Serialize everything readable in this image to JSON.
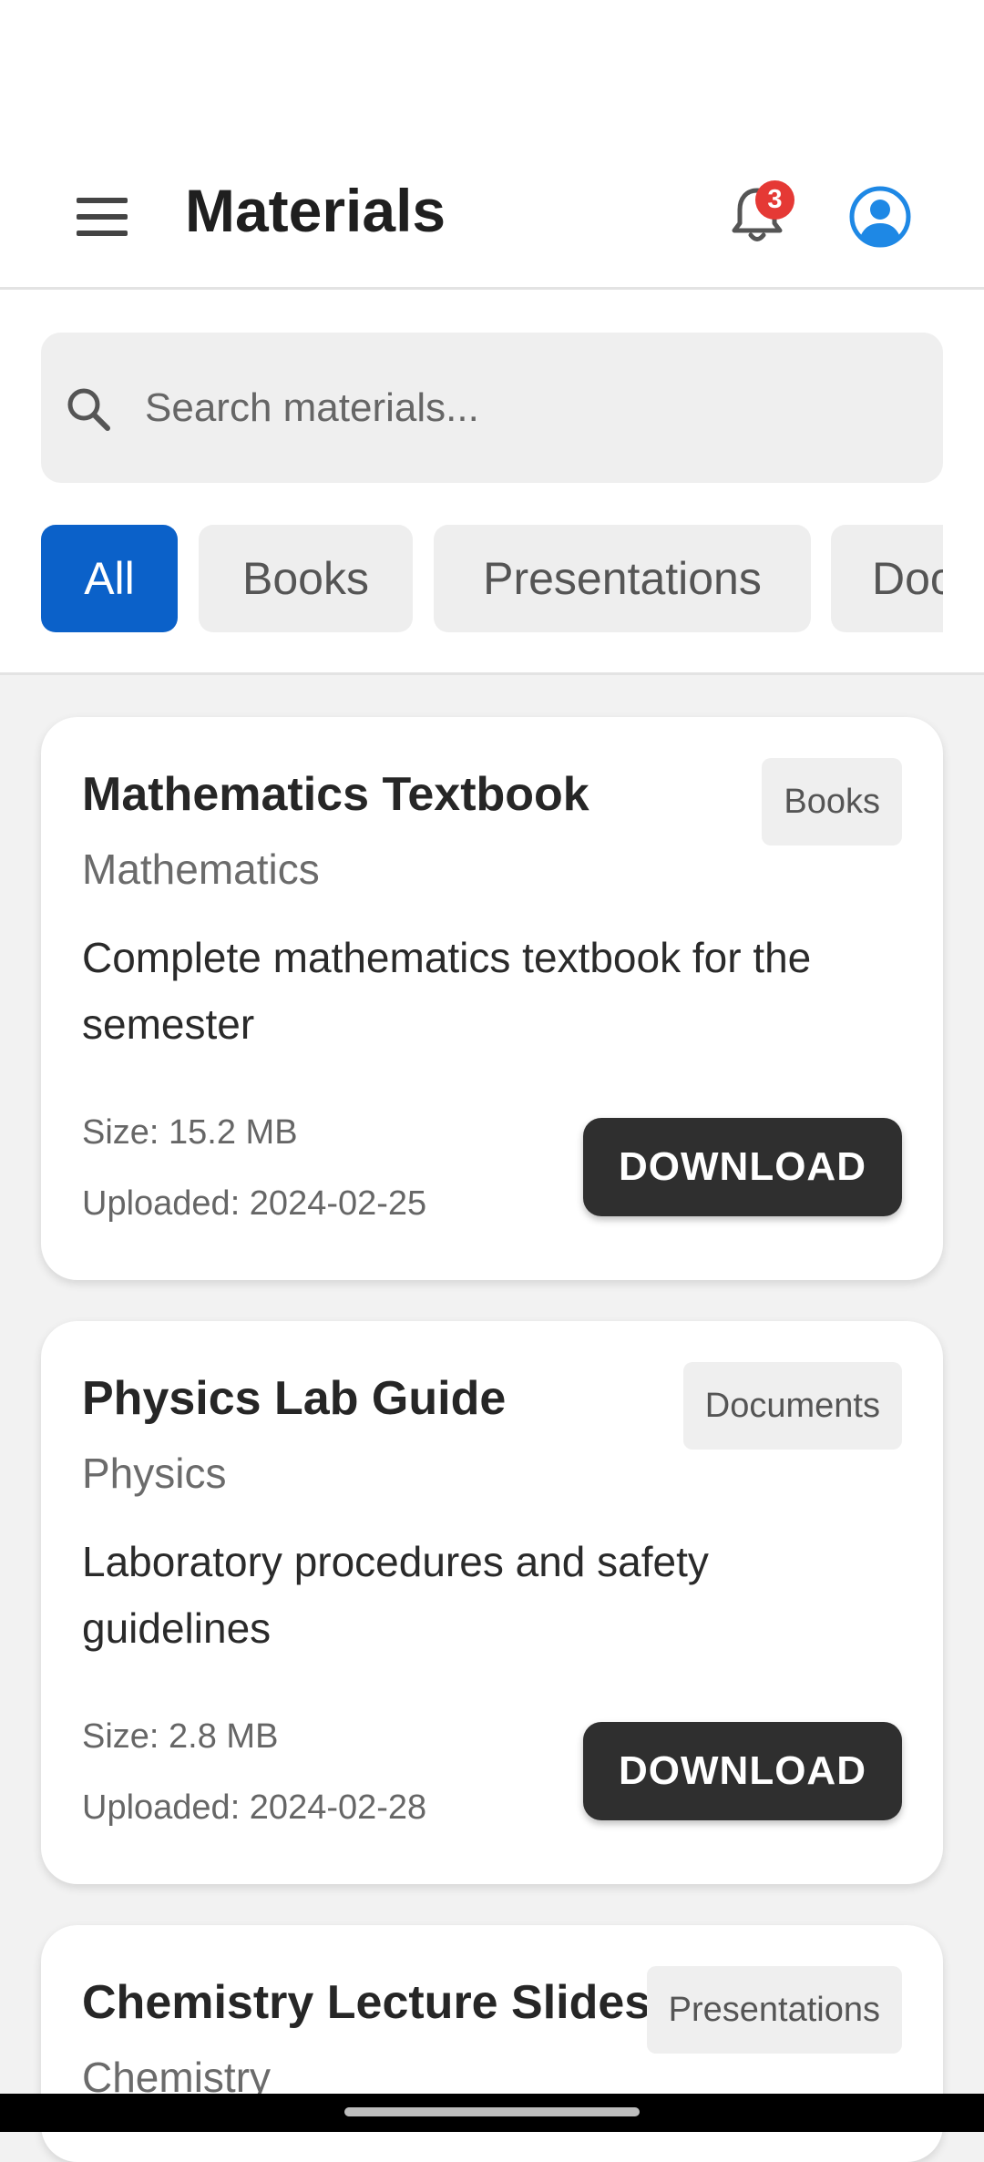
{
  "header": {
    "title": "Materials",
    "notification_count": "3"
  },
  "search": {
    "placeholder": "Search materials..."
  },
  "filters": [
    "All",
    "Books",
    "Presentations",
    "Documents"
  ],
  "active_filter": "All",
  "materials": [
    {
      "title": "Mathematics Textbook",
      "subject": "Mathematics",
      "category": "Books",
      "description": "Complete mathematics textbook for the semester",
      "size": "Size: 15.2 MB",
      "uploaded": "Uploaded: 2024-02-25",
      "action": "DOWNLOAD"
    },
    {
      "title": "Physics Lab Guide",
      "subject": "Physics",
      "category": "Documents",
      "description": "Laboratory procedures and safety guidelines",
      "size": "Size: 2.8 MB",
      "uploaded": "Uploaded: 2024-02-28",
      "action": "DOWNLOAD"
    },
    {
      "title": "Chemistry Lecture Slides",
      "subject": "Chemistry",
      "category": "Presentations"
    }
  ],
  "colors": {
    "accent": "#0b61c9",
    "badge": "#e53935",
    "download_button": "#2f2f2f",
    "profile_icon": "#1e88e5"
  },
  "icons": {
    "menu": "hamburger-menu-icon",
    "notifications": "bell-icon",
    "profile": "account-circle-icon",
    "search": "search-icon"
  }
}
